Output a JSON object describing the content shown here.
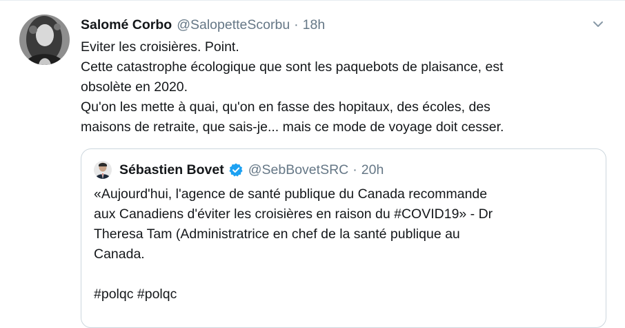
{
  "tweet": {
    "author_name": "Salomé Corbo",
    "author_handle": "@SalopetteScorbu",
    "separator": "·",
    "time": "18h",
    "text_lines": [
      "Eviter les croisières.  Point.",
      "Cette catastrophe écologique que sont les paquebots de plaisance, est",
      "obsolète en 2020.",
      "Qu'on les mette à quai, qu'on en fasse des hopitaux, des écoles, des",
      "maisons de retraite, que sais-je... mais ce mode de voyage doit cesser."
    ]
  },
  "quoted": {
    "author_name": "Sébastien Bovet",
    "author_handle": "@SebBovetSRC",
    "separator": "·",
    "time": "20h",
    "text_lines": [
      "«Aujourd'hui, l'agence de santé publique du Canada recommande",
      "aux Canadiens d'éviter les croisières en raison du #COVID19» - Dr",
      "Theresa Tam (Administratrice en chef de la santé publique au",
      "Canada."
    ],
    "hashtags_line": "#polqc #polqc"
  },
  "icons": {
    "caret": "chevron-down-icon",
    "verified": "verified-badge-icon"
  },
  "colors": {
    "text": "#14171a",
    "secondary": "#657786",
    "border": "#ccd6dd",
    "verified": "#1da1f2"
  }
}
